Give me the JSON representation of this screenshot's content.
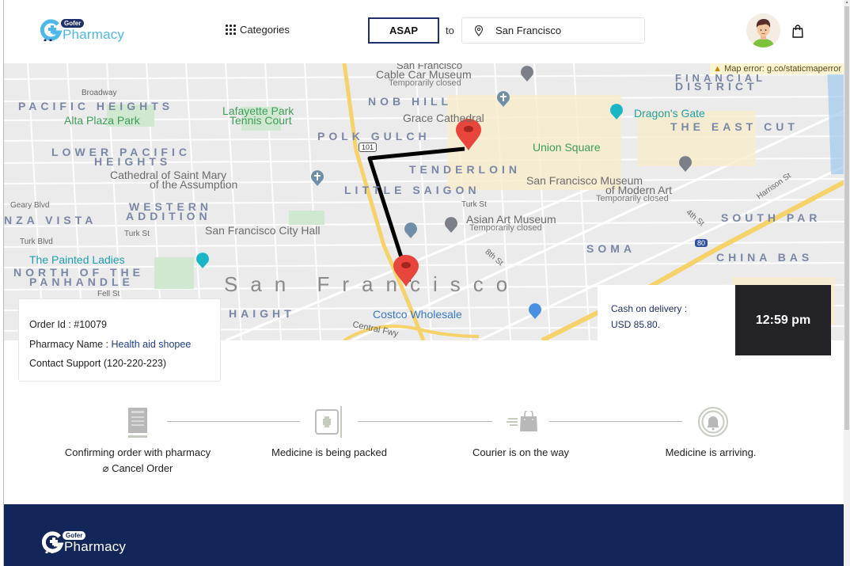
{
  "header": {
    "logo": {
      "badge": "Gofer",
      "name": "Pharmacy"
    },
    "categories_label": "Categories",
    "schedule_button": "ASAP",
    "to_label": "to",
    "location_value": "San Francisco"
  },
  "map": {
    "error_text": "Map error: g.co/staticmaperror",
    "labels": {
      "sf_top": "San Francisco",
      "cable_car": "Cable Car Museum",
      "temp_closed_1": "Temporarily closed",
      "financial": "FINANCIAL",
      "district": "DISTRICT",
      "broadway": "Broadway",
      "pacific_heights": "PACIFIC HEIGHTS",
      "lafayette": "Lafayette Park",
      "tennis": "Tennis Court",
      "alta_plaza": "Alta Plaza Park",
      "nob_hill": "NOB HILL",
      "grace": "Grace Cathedral",
      "dragons_gate": "Dragon's Gate",
      "east_cut": "THE EAST CUT",
      "polk_gulch": "POLK GULCH",
      "union_square": "Union Square",
      "lower_pacific": "LOWER PACIFIC",
      "heights": "HEIGHTS",
      "tenderloin": "TENDERLOIN",
      "cathedral_mary": "Cathedral of Saint Mary",
      "assumption": "of the Assumption",
      "little_saigon": "LITTLE SAIGON",
      "sfmoma_1": "San Francisco Museum",
      "sfmoma_2": "of Modern Art",
      "temp_closed_2": "Temporarily closed",
      "geary": "Geary Blvd",
      "western": "WESTERN",
      "addition": "ADDITION",
      "anza_vista": "NZA VISTA",
      "turk_st": "Turk St",
      "asian_art": "Asian Art Museum",
      "temp_closed_3": "Temporarily closed",
      "south_park": "SOUTH PAR",
      "turk_blvd": "Turk Blvd",
      "turk_st_2": "Turk St",
      "sf_city_hall": "San Francisco City Hall",
      "harrison": "Harrison St",
      "fourth_st": "4th St",
      "painted_ladies": "The Painted Ladies",
      "eighth_st": "8th St",
      "soma": "SOMA",
      "china_basin": "CHINA BAS",
      "north_of": "NORTH OF THE",
      "panhandle": "PANHANDLE",
      "fell_st": "Fell St",
      "san_francisco_big": "San Francisco",
      "haight": "HAIGHT",
      "costco": "Costco Wholesale",
      "central_fwy": "Central Fwy",
      "hwy_101": "101",
      "hwy_80": "80"
    }
  },
  "order": {
    "order_id_label": "Order Id : ",
    "order_id": "#10079",
    "pharmacy_label": "Pharmacy Name : ",
    "pharmacy_name": "Health aid shopee",
    "support_label": "Contact Support",
    "support_phone": "(120-220-223)"
  },
  "payment": {
    "method": "Cash on delivery :",
    "amount": "USD 85.80."
  },
  "eta": "12:59 pm",
  "steps": [
    {
      "label": "Confirming order with pharmacy",
      "icon": "receipt-icon"
    },
    {
      "label": "Medicine is being packed",
      "icon": "medical-box-icon"
    },
    {
      "label": "Courier is on the way",
      "icon": "delivery-bag-icon"
    },
    {
      "label": "Medicine is arriving.",
      "icon": "bell-icon"
    }
  ],
  "cancel_label": "⌀ Cancel Order",
  "footer": {
    "logo": {
      "badge": "Gofer",
      "name": "Pharmacy"
    }
  },
  "colors": {
    "brand_navy": "#13265a",
    "brand_blue": "#4fb8ea",
    "eta_bg": "#232227",
    "pin_red": "#e8453c"
  }
}
